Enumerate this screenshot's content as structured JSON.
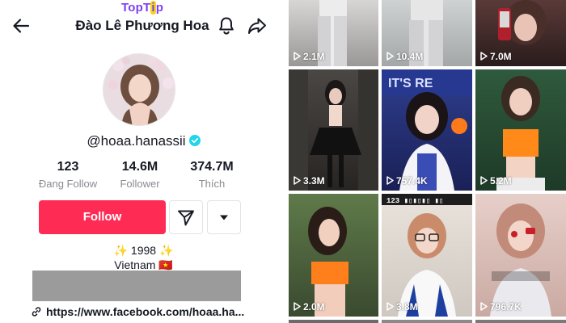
{
  "watermark": {
    "text_a": "TopT",
    "text_b": "i",
    "text_c": "p"
  },
  "header": {
    "title": "Đào Lê Phương Hoa"
  },
  "profile": {
    "handle": "@hoaa.hanassii",
    "stats": [
      {
        "value": "123",
        "label": "Đang Follow"
      },
      {
        "value": "14.6M",
        "label": "Follower"
      },
      {
        "value": "374.7M",
        "label": "Thích"
      }
    ],
    "follow_label": "Follow",
    "bio_line1": "✨ 1998 ✨",
    "bio_line2": "Vietnam 🇻🇳",
    "link": "https://www.facebook.com/hoaa.ha..."
  },
  "videos": [
    {
      "views": "2.1M"
    },
    {
      "views": "10.4M"
    },
    {
      "views": "7.0M"
    },
    {
      "views": "3.3M"
    },
    {
      "views": "757.4K"
    },
    {
      "views": "5.2M"
    },
    {
      "views": "2.0M"
    },
    {
      "views": "3.8M"
    },
    {
      "views": "796.7K"
    }
  ],
  "colors": {
    "accent": "#fe2c55",
    "verified": "#20d5ec",
    "watermark": "#7b3ff2"
  },
  "icons": [
    "back-arrow-icon",
    "bell-icon",
    "share-icon",
    "verified-icon",
    "send-message-icon",
    "dropdown-triangle-icon",
    "link-icon",
    "play-icon"
  ]
}
